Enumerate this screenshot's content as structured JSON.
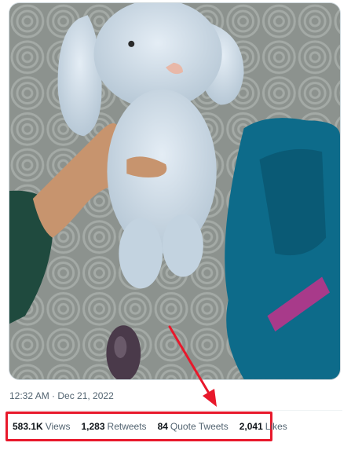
{
  "tweet": {
    "timestamp": "12:32 AM · Dec 21, 2022",
    "stats": [
      {
        "value": "583.1K",
        "label": "Views"
      },
      {
        "value": "1,283",
        "label": "Retweets"
      },
      {
        "value": "84",
        "label": "Quote Tweets"
      },
      {
        "value": "2,041",
        "label": "Likes"
      }
    ]
  },
  "colors": {
    "highlight": "#e8182b",
    "secondary_text": "#536471",
    "primary_text": "#0f1419"
  }
}
